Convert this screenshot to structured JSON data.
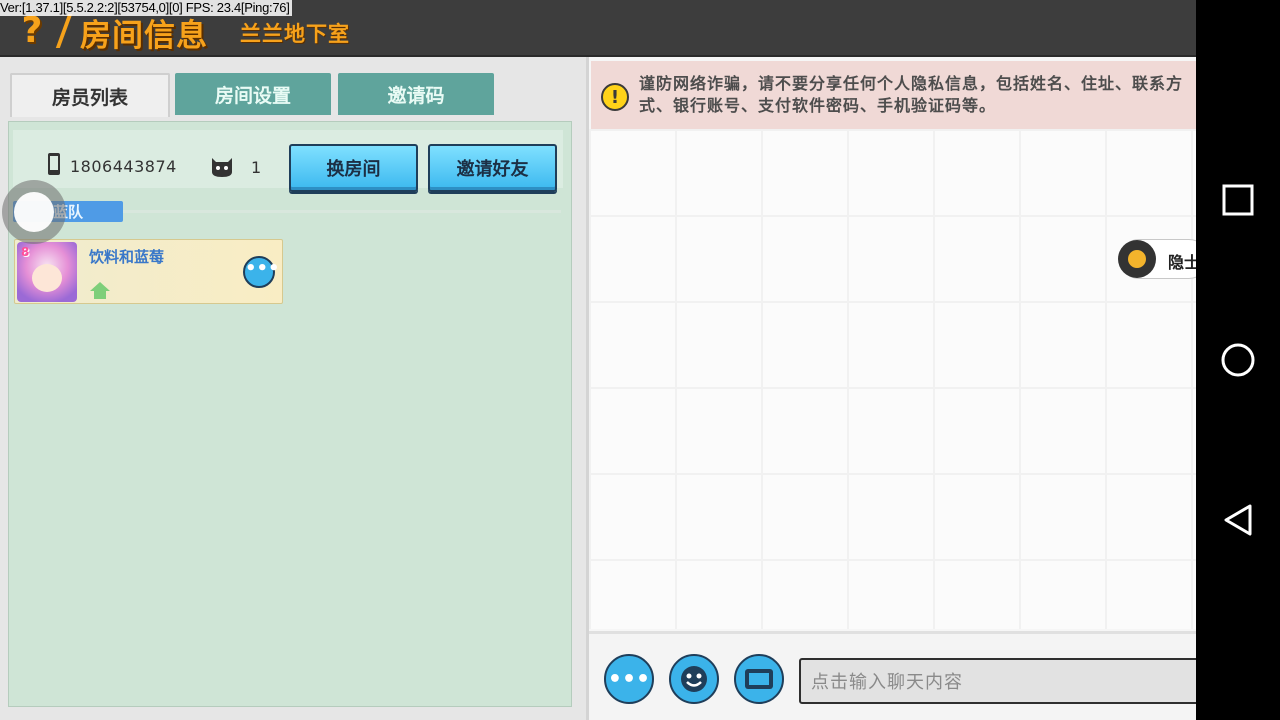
{
  "debug_overlay": "Ver:[1.37.1][5.5.2.2:2][53754,0][0] FPS: 23.4[Ping:76]",
  "header": {
    "help_glyph": "?",
    "title": "房间信息",
    "subtitle": "兰兰地下室"
  },
  "tabs": [
    {
      "label": "房员列表",
      "active": true
    },
    {
      "label": "房间设置",
      "active": false
    },
    {
      "label": "邀请码",
      "active": false
    }
  ],
  "room": {
    "id": "1806443874",
    "member_count": "1",
    "change_room_label": "换房间",
    "invite_friend_label": "邀请好友"
  },
  "team": {
    "label": "蓝队",
    "members": [
      {
        "name": "饮料和蓝莓",
        "avatar_badge": "8"
      }
    ]
  },
  "chat": {
    "notice": "谨防网络诈骗，请不要分享任何个人隐私信息，包括姓名、住址、联系方式、银行账号、支付软件密码、手机验证码等。",
    "floating_label": "隐士",
    "input_placeholder": "点击输入聊天内容",
    "more_glyph": "•••"
  },
  "colors": {
    "accent_orange": "#f7a21b",
    "button_blue": "#3bb8ef",
    "team_blue": "#4f9be6",
    "panel_green": "#cfe5d6",
    "tab_inactive": "#5fa49c"
  },
  "icons": [
    "help-icon",
    "phone-icon",
    "bot-icon",
    "home-icon",
    "warning-icon",
    "emoji-icon",
    "keyboard-icon",
    "square-recents-icon",
    "circle-home-icon",
    "triangle-back-icon"
  ]
}
